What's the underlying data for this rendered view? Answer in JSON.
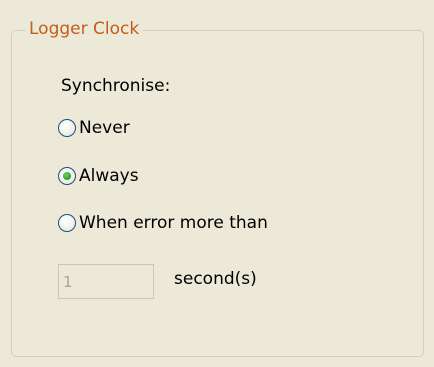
{
  "group": {
    "title": "Logger Clock"
  },
  "synchronise": {
    "label": "Synchronise:",
    "selected": "always",
    "options": [
      {
        "id": "never",
        "label": "Never",
        "checked": false
      },
      {
        "id": "always",
        "label": "Always",
        "checked": true
      },
      {
        "id": "when-error",
        "label": "When error more than",
        "checked": false
      }
    ]
  },
  "threshold": {
    "value": "1",
    "disabled": true,
    "unit": "second(s)"
  },
  "colors": {
    "background": "#ECE9D8",
    "group_title": "#C35E1A",
    "group_border": "#D0D0BF",
    "radio_border": "#1C5180",
    "radio_selected_dot": "#2FA52F",
    "disabled_text": "#A7A69B"
  }
}
